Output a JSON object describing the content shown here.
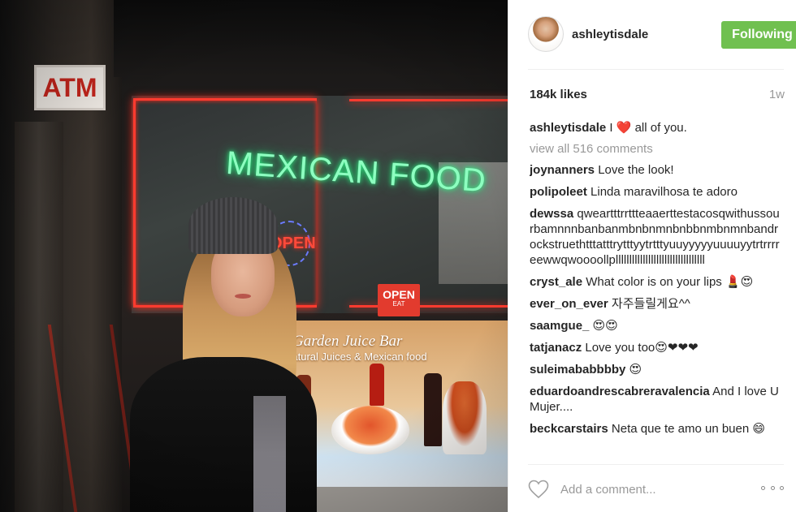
{
  "photo": {
    "atm_sign": "ATM",
    "neon_sign": "MEXICAN FOOD",
    "open_neon": "OPEN",
    "open_card": "OPEN",
    "open_card_sub": "EAT",
    "poster_title": "Garden Juice Bar",
    "poster_sub": "Natural Juices & Mexican food"
  },
  "header": {
    "username": "ashleytisdale",
    "follow_label": "Following"
  },
  "stats": {
    "likes": "184k likes",
    "time": "1w"
  },
  "caption": {
    "user": "ashleytisdale",
    "text_before": "I ",
    "heart": "❤️",
    "text_after": " all of you."
  },
  "view_all": "view all 516 comments",
  "comments": [
    {
      "user": "joynanners",
      "text": "Love the look!"
    },
    {
      "user": "polipoleet",
      "text": "Linda maravilhosa te adoro"
    },
    {
      "user": "dewssa",
      "text": "qweartttrrttteaaerttestacosqwithussourbamnnnbanbanmbnbnmnbnbbnmbnmnbandrockstruethtttatttrytttyytrtttyuuyyyyyuuuuyytrtrrrreewwqwoooollplllllllllllllllllllllllllllllllll"
    },
    {
      "user": "cryst_ale",
      "text": "What color is on your lips 💄😍"
    },
    {
      "user": "ever_on_ever",
      "text": "자주들릴게요^^"
    },
    {
      "user": "saamgue_",
      "text": "😍😍"
    },
    {
      "user": "tatjanacz",
      "text": "Love you too😍❤❤❤"
    },
    {
      "user": "suleimababbbby",
      "text": "😍"
    },
    {
      "user": "eduardoandrescabreravalencia",
      "text": "And I love U Mujer...."
    },
    {
      "user": "beckcarstairs",
      "text": "Neta que te amo un buen 😄"
    }
  ],
  "composer": {
    "placeholder": "Add a comment..."
  },
  "colors": {
    "follow_bg": "#70c050",
    "muted": "#999999",
    "text": "#262626"
  }
}
